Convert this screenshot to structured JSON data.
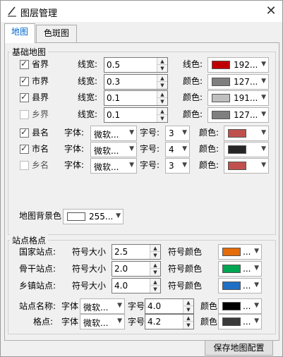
{
  "window": {
    "title": "图层管理",
    "close": "✕"
  },
  "tabs": [
    "地图",
    "色斑图"
  ],
  "basemap": {
    "group_title": "基础地图",
    "line_rows": [
      {
        "checked": true,
        "name": "省界",
        "width_label": "线宽:",
        "width": "0.5",
        "color_label": "线色:",
        "color_text": "192...",
        "color": "#c00000"
      },
      {
        "checked": true,
        "name": "市界",
        "width_label": "线宽:",
        "width": "0.3",
        "color_label": "颜色:",
        "color_text": "127...",
        "color": "#7f7f7f"
      },
      {
        "checked": true,
        "name": "县界",
        "width_label": "线宽:",
        "width": "0.1",
        "color_label": "颜色:",
        "color_text": "191...",
        "color": "#bfbfbf"
      },
      {
        "checked": false,
        "name": "乡界",
        "width_label": "线宽:",
        "width": "0.1",
        "color_label": "颜色:",
        "color_text": "127...",
        "color": "#7f7f7f"
      }
    ],
    "label_rows": [
      {
        "checked": true,
        "name": "县名",
        "font_label": "字体:",
        "font": "微软...",
        "size_label": "字号:",
        "size": "3",
        "color_label": "颜色:",
        "color": "#c0504d"
      },
      {
        "checked": true,
        "name": "市名",
        "font_label": "字体:",
        "font": "微软...",
        "size_label": "字号:",
        "size": "4",
        "color_label": "颜色:",
        "color": "#262626"
      },
      {
        "checked": false,
        "name": "乡名",
        "font_label": "字体:",
        "font": "微软...",
        "size_label": "字号:",
        "size": "3",
        "color_label": "颜色:",
        "color": "#c0504d"
      }
    ],
    "bg_label": "地图背景色",
    "bg_text": "255...",
    "bg_color": "#ffffff"
  },
  "stations": {
    "group_title": "站点格点",
    "rows": [
      {
        "name": "国家站点:",
        "size_label": "符号大小",
        "size": "2.5",
        "color_label": "符号颜色",
        "color": "#e46c0a"
      },
      {
        "name": "骨干站点:",
        "size_label": "符号大小",
        "size": "2.0",
        "color_label": "符号颜色",
        "color": "#00a651"
      },
      {
        "name": "乡镇站点:",
        "size_label": "符号大小",
        "size": "4.0",
        "color_label": "符号颜色",
        "color": "#1f6fc5"
      }
    ],
    "font_rows": [
      {
        "name": "站点名称:",
        "font_label": "字体",
        "font": "微软...",
        "size_label": "字号",
        "size": "4.0",
        "color_label": "颜色",
        "color": "#000000"
      },
      {
        "name": "格点:",
        "font_label": "字体",
        "font": "微软...",
        "size_label": "字号",
        "size": "4.2",
        "color_label": "颜色",
        "color": "#3a3a3a"
      }
    ],
    "combo_dots": "..."
  },
  "footer": {
    "save_label": "保存地图配置"
  }
}
